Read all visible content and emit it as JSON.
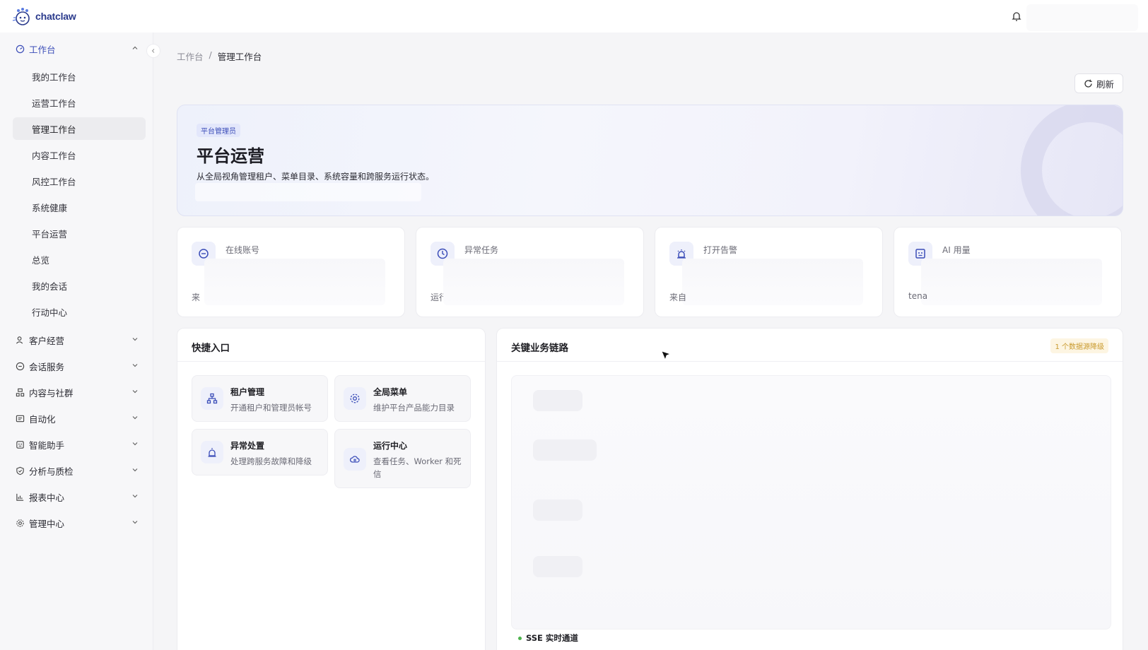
{
  "app": {
    "name": "chatclaw"
  },
  "sidebar": {
    "workspace_group": {
      "label": "工作台"
    },
    "items": [
      {
        "label": "我的工作台"
      },
      {
        "label": "运营工作台"
      },
      {
        "label": "管理工作台"
      },
      {
        "label": "内容工作台"
      },
      {
        "label": "风控工作台"
      },
      {
        "label": "系统健康"
      },
      {
        "label": "平台运营"
      },
      {
        "label": "总览"
      },
      {
        "label": "我的会话"
      },
      {
        "label": "行动中心"
      }
    ],
    "groups": [
      {
        "label": "客户经营",
        "icon": "customer-icon"
      },
      {
        "label": "会话服务",
        "icon": "chat-icon"
      },
      {
        "label": "内容与社群",
        "icon": "community-icon"
      },
      {
        "label": "自动化",
        "icon": "automation-icon"
      },
      {
        "label": "智能助手",
        "icon": "assistant-icon"
      },
      {
        "label": "分析与质检",
        "icon": "shield-icon"
      },
      {
        "label": "报表中心",
        "icon": "chart-icon"
      },
      {
        "label": "管理中心",
        "icon": "gear-icon"
      }
    ]
  },
  "breadcrumb": {
    "root": "工作台",
    "separator": "/",
    "current": "管理工作台"
  },
  "toolbar": {
    "refresh_label": "刷新"
  },
  "hero": {
    "badge": "平台管理员",
    "title": "平台运营",
    "description": "从全局视角管理租户、菜单目录、系统容量和跨服务运行状态。"
  },
  "stats": [
    {
      "label": "在线账号",
      "foot": "来",
      "icon": "chat-icon"
    },
    {
      "label": "异常任务",
      "foot": "运行",
      "icon": "clock-icon"
    },
    {
      "label": "打开告警",
      "foot": "来自",
      "icon": "alarm-icon"
    },
    {
      "label": "AI 用量",
      "foot": "tena",
      "icon": "robot-icon"
    }
  ],
  "quick_entry": {
    "title": "快捷入口",
    "cards": [
      {
        "title": "租户管理",
        "desc": "开通租户和管理员帐号",
        "icon": "org-icon"
      },
      {
        "title": "全局菜单",
        "desc": "维护平台产品能力目录",
        "icon": "gear-icon"
      },
      {
        "title": "异常处置",
        "desc": "处理跨服务故障和降级",
        "icon": "alarm-icon"
      },
      {
        "title": "运行中心",
        "desc": "查看任务、Worker 和死信",
        "icon": "cloud-icon"
      }
    ]
  },
  "business_chain": {
    "title": "关键业务链路",
    "badge": "1 个数据源降级",
    "sse_label": "SSE 实时通道"
  },
  "colors": {
    "accent": "#3b4db8",
    "status_ok": "#4cb34c",
    "warning": "#c99a2e"
  }
}
